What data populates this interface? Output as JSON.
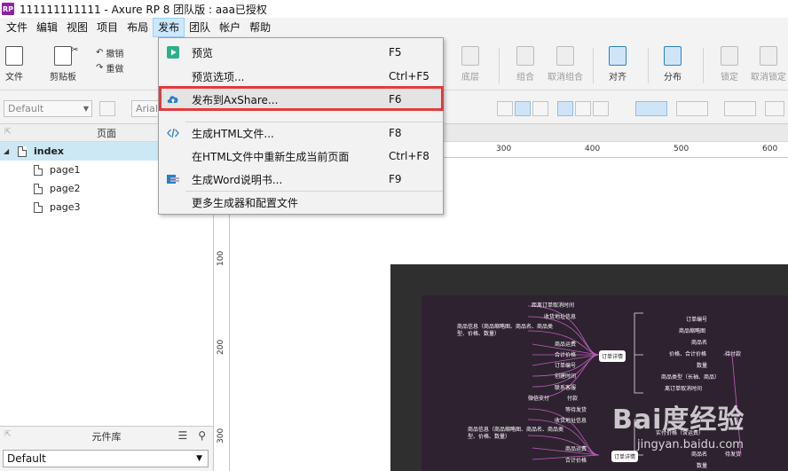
{
  "window": {
    "app_icon": "RP",
    "title": "111111111111 - Axure RP 8 团队版 : aaa已授权"
  },
  "menubar": [
    "文件",
    "编辑",
    "视图",
    "项目",
    "布局",
    "发布",
    "团队",
    "帐户",
    "帮助"
  ],
  "toolbar": {
    "file_label": "文件",
    "clipboard_label": "剪贴板",
    "undo_label": "撤销",
    "redo_label": "重做",
    "bottom_layer_label": "底层",
    "group_label": "组合",
    "ungroup_label": "取消组合",
    "align_label": "对齐",
    "distribute_label": "分布",
    "lock_label": "锁定",
    "unlock_label": "取消锁定"
  },
  "formatbar": {
    "style_value": "Default",
    "font_value": "Arial"
  },
  "publish_menu": [
    {
      "label": "预览",
      "shortcut": "F5",
      "icon": "play-icon"
    },
    {
      "label": "预览选项...",
      "shortcut": "Ctrl+F5",
      "icon": ""
    },
    {
      "label": "发布到AxShare...",
      "shortcut": "F6",
      "icon": "cloud-upload-icon"
    },
    {
      "label": "生成HTML文件...",
      "shortcut": "F8",
      "icon": "code-icon"
    },
    {
      "label": "在HTML文件中重新生成当前页面",
      "shortcut": "Ctrl+F8",
      "icon": ""
    },
    {
      "label": "生成Word说明书...",
      "shortcut": "F9",
      "icon": "word-doc-icon"
    },
    {
      "label": "更多生成器和配置文件",
      "shortcut": "",
      "icon": ""
    }
  ],
  "pages_panel": {
    "title": "页面",
    "root": "index",
    "children": [
      "page1",
      "page2",
      "page3"
    ]
  },
  "library_panel": {
    "title": "元件库",
    "selected": "Default"
  },
  "rulers": {
    "h": [
      "300",
      "400",
      "500",
      "600"
    ],
    "v": [
      "100",
      "200",
      "300"
    ]
  },
  "mindmap": {
    "order_details": "订单详情",
    "left_nodes": [
      "距离订单取消时间",
      "收货地址信息",
      "商品信息（商品缩略图、商品名、商品类型、价格、数量）",
      "商品运费",
      "合计价格",
      "订单编号",
      "创建时间",
      "联系客服",
      "微信支付",
      "付款"
    ],
    "right_nodes": [
      "订单编号",
      "商品缩略图",
      "商品名",
      "价格、合计价格",
      "数量",
      "商品类型（长袖、商品）",
      "离订单取消时间"
    ],
    "pending_payment": "待付款",
    "lower_left": [
      "等待发货",
      "收货地址信息",
      "商品信息（商品缩略图、商品名、商品类型、价格、数量）",
      "商品运费",
      "合计价格"
    ],
    "lower_right": [
      "实付价格（含运费）",
      "商品名",
      "数量"
    ],
    "pending_shipment": "待发货"
  },
  "watermark": {
    "brand": "Bai度经验",
    "url": "jingyan.baidu.com"
  }
}
